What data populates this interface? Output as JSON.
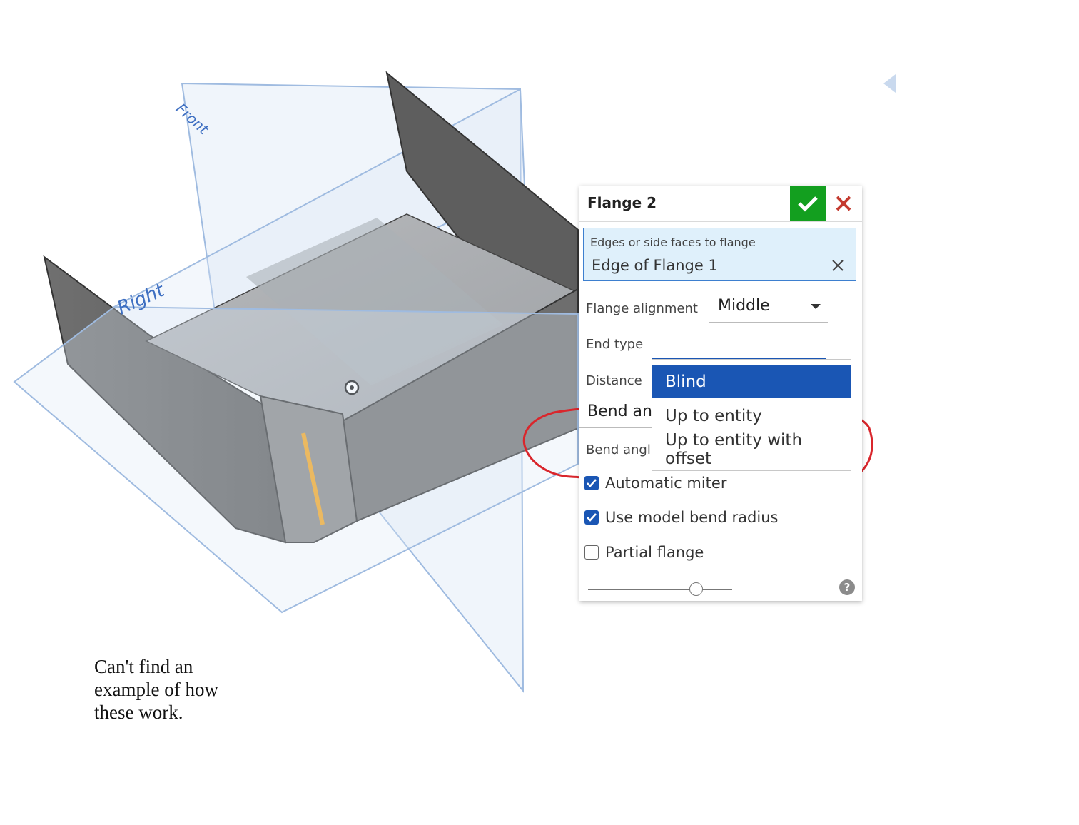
{
  "viewport": {
    "planes": [
      {
        "name": "Front"
      },
      {
        "name": "Right"
      }
    ]
  },
  "feature_dialog": {
    "title": "Flange 2",
    "query": {
      "label": "Edges or side faces to flange",
      "value": "Edge of Flange 1"
    },
    "flange_alignment": {
      "label": "Flange alignment",
      "value": "Middle"
    },
    "end_type": {
      "label": "End type",
      "options": [
        "Blind",
        "Up to entity",
        "Up to entity with offset"
      ],
      "selected": "Blind"
    },
    "distance_label": "Distance",
    "bend_angle_field_label": "Bend an",
    "bend_angle_label": "Bend angl",
    "checkboxes": [
      {
        "label": "Automatic miter",
        "checked": true
      },
      {
        "label": "Use model bend radius",
        "checked": true
      },
      {
        "label": "Partial flange",
        "checked": false
      }
    ],
    "help": "?"
  },
  "annotation": {
    "note": "Can't find an example of how these work.",
    "highlight_color": "#d9262c"
  },
  "colors": {
    "accept": "#139f1f",
    "cancel": "#c43a2f",
    "selection": "#1a56b4",
    "plane": "#a9c4e6"
  }
}
